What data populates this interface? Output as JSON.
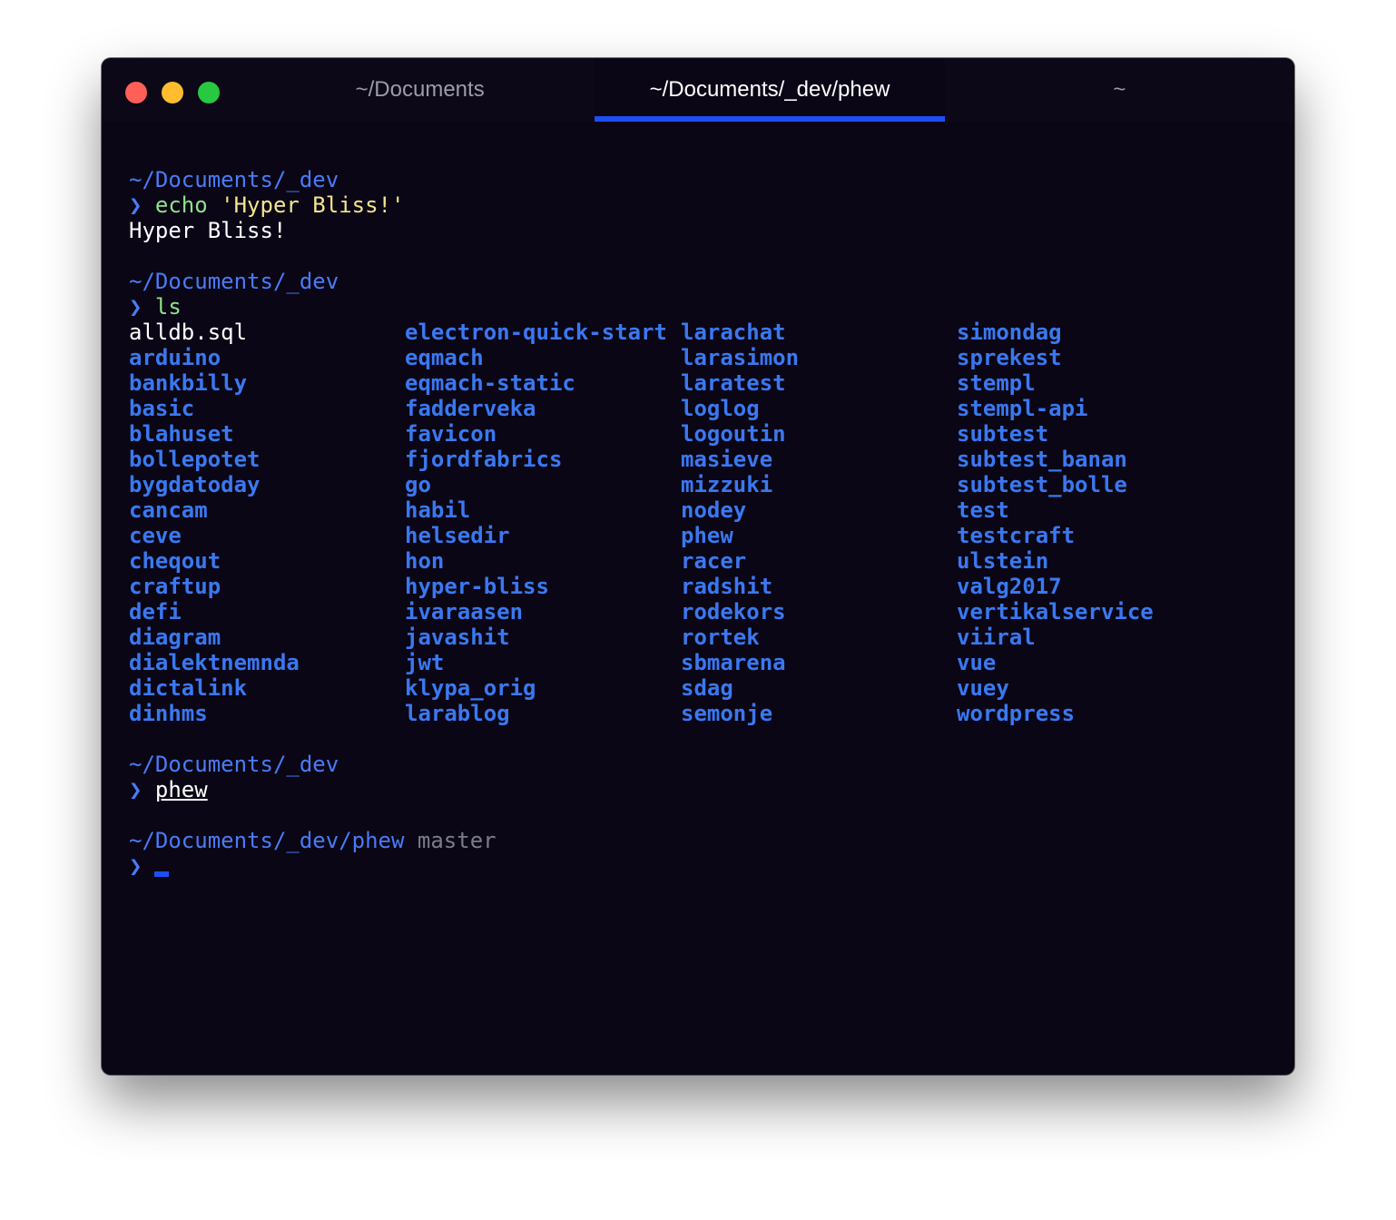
{
  "tabs": [
    {
      "label": "~/Documents",
      "active": false
    },
    {
      "label": "~/Documents/_dev/phew",
      "active": true
    },
    {
      "label": "~",
      "active": false
    }
  ],
  "colors": {
    "background": "#0a0616",
    "accent": "#1c4ff5",
    "path": "#4a7bf5",
    "command": "#8ee28a",
    "string": "#f2e68a",
    "directory": "#3a78f0"
  },
  "prompt_symbol": "❯",
  "blocks": {
    "echo": {
      "path": "~/Documents/_dev",
      "command": "echo",
      "argument": "'Hyper Bliss!'",
      "output": "Hyper Bliss!"
    },
    "ls": {
      "path": "~/Documents/_dev",
      "command": "ls",
      "columns": [
        [
          "alldb.sql",
          "arduino",
          "bankbilly",
          "basic",
          "blahuset",
          "bollepotet",
          "bygdatoday",
          "cancam",
          "ceve",
          "cheqout",
          "craftup",
          "defi",
          "diagram",
          "dialektnemnda",
          "dictalink",
          "dinhms"
        ],
        [
          "electron-quick-start",
          "eqmach",
          "eqmach-static",
          "fadderveka",
          "favicon",
          "fjordfabrics",
          "go",
          "habil",
          "helsedir",
          "hon",
          "hyper-bliss",
          "ivaraasen",
          "javashit",
          "jwt",
          "klypa_orig",
          "larablog"
        ],
        [
          "larachat",
          "larasimon",
          "laratest",
          "loglog",
          "logoutin",
          "masieve",
          "mizzuki",
          "nodey",
          "phew",
          "racer",
          "radshit",
          "rodekors",
          "rortek",
          "sbmarena",
          "sdag",
          "semonje"
        ],
        [
          "simondag",
          "sprekest",
          "stempl",
          "stempl-api",
          "subtest",
          "subtest_banan",
          "subtest_bolle",
          "test",
          "testcraft",
          "ulstein",
          "valg2017",
          "vertikalservice",
          "viiral",
          "vue",
          "vuey",
          "wordpress"
        ]
      ],
      "files": [
        "alldb.sql"
      ]
    },
    "phew": {
      "path": "~/Documents/_dev",
      "command": "phew"
    },
    "current": {
      "path": "~/Documents/_dev/phew",
      "branch": "master"
    }
  }
}
